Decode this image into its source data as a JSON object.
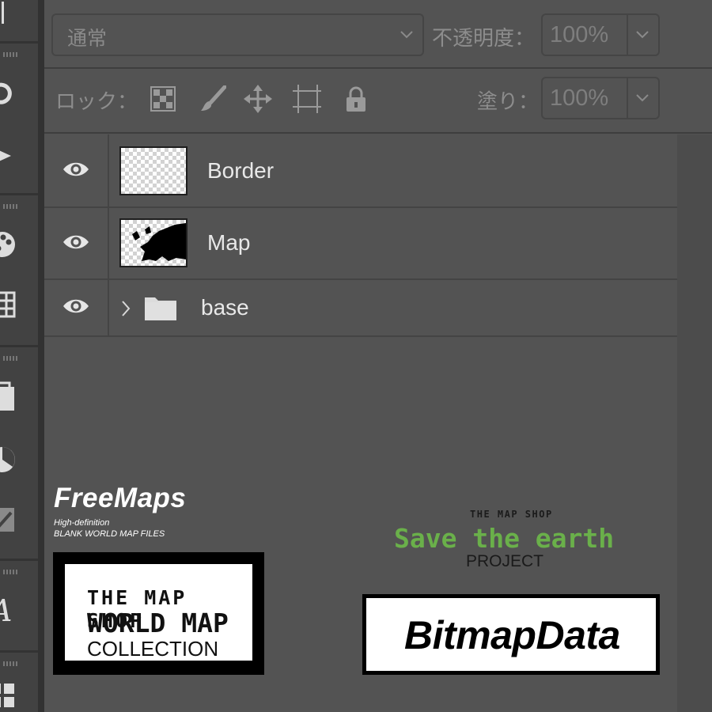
{
  "blend": {
    "mode_value": "通常"
  },
  "opacity": {
    "label": "不透明度：",
    "value": "100%"
  },
  "lock": {
    "label": "ロック："
  },
  "fill": {
    "label": "塗り：",
    "value": "100%"
  },
  "layers": [
    {
      "name": "Border",
      "visible": true,
      "type": "layer"
    },
    {
      "name": "Map",
      "visible": true,
      "type": "layer"
    },
    {
      "name": "base",
      "visible": true,
      "type": "group"
    }
  ],
  "logos": {
    "freemaps": {
      "title": "FreeMaps",
      "sub1": "High-definition",
      "sub2": "BLANK WORLD MAP FILES"
    },
    "mapshop": {
      "line1": "THE MAP SHOP",
      "line2": "WORLD MAP",
      "line3": "COLLECTION"
    },
    "save_earth": {
      "small": "THE MAP SHOP",
      "main": "Save the earth",
      "sub": "PROJECT",
      "color": "#6ab04a"
    },
    "bitmapdata": {
      "text": "BitmapData"
    }
  },
  "icons": {
    "eye": "eye-icon",
    "chevron": "chevron-down-icon",
    "folder": "folder-icon",
    "lock_transparent": "checkerboard-icon",
    "lock_paint": "brush-icon",
    "lock_move": "move-arrows-icon",
    "lock_artboard": "artboard-icon",
    "lock_all": "padlock-icon"
  }
}
